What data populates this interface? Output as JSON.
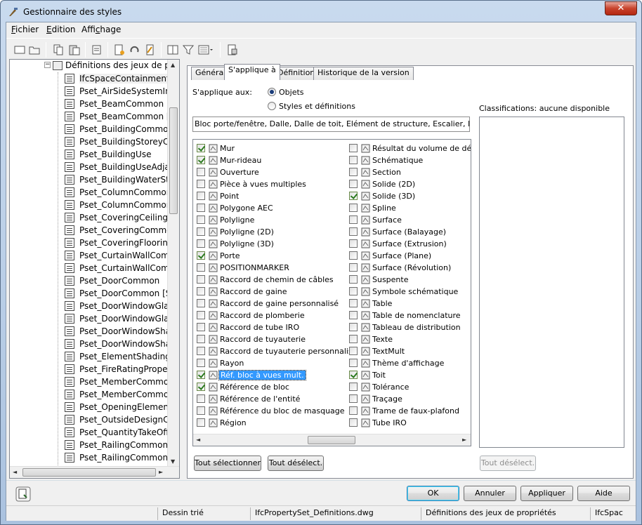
{
  "window": {
    "title": "Gestionnaire des styles",
    "close_symbol": "✕"
  },
  "menu": [
    {
      "label": "Fichier",
      "accel": "F",
      "rest": "ichier"
    },
    {
      "label": "Edition",
      "accel": "E",
      "rest": "dition"
    },
    {
      "label": "Affichage",
      "pre": "Affi",
      "accel": "c",
      "rest": "hage"
    }
  ],
  "toolbar": {
    "icons": [
      "new-drawing-icon",
      "open-drawing-icon",
      "copy-icon",
      "paste-icon",
      "purge-icon",
      "new-style-icon",
      "edit-style-icon",
      "set-from-icon",
      "toggle-view-icon",
      "filter-icon",
      "view-mode-icon",
      "synchronize-icon"
    ]
  },
  "tree": {
    "root_label": "Définitions des jeux de pro",
    "items": [
      "IfcSpaceContainment",
      "Pset_AirSideSystemInfo",
      "Pset_BeamCommon",
      "Pset_BeamCommon [S",
      "Pset_BuildingCommon",
      "Pset_BuildingStoreyCo",
      "Pset_BuildingUse",
      "Pset_BuildingUseAdjac",
      "Pset_BuildingWaterSto",
      "Pset_ColumnCommon",
      "Pset_ColumnCommon",
      "Pset_CoveringCeiling",
      "Pset_CoveringCommo",
      "Pset_CoveringFlooring",
      "Pset_CurtainWallComr",
      "Pset_CurtainWallComr",
      "Pset_DoorCommon",
      "Pset_DoorCommon [St",
      "Pset_DoorWindowGlaz",
      "Pset_DoorWindowGlaz",
      "Pset_DoorWindowShac",
      "Pset_DoorWindowShac",
      "Pset_ElementShading",
      "Pset_FireRatingPropert",
      "Pset_MemberCommon",
      "Pset_MemberCommor",
      "Pset_OpeningElementC",
      "Pset_OutsideDesignCri",
      "Pset_QuantityTakeOff",
      "Pset_RailingCommon",
      "Pset_RailingCommon |"
    ]
  },
  "tabs": [
    "Général",
    "S'applique à",
    "Définition",
    "Historique de la version"
  ],
  "applies": {
    "label": "S'applique aux:",
    "radio_objects": "Objets",
    "radio_styles": "Styles et définitions",
    "summary": "Bloc porte/fenêtre, Dalle, Dalle de toit, Elément de structure, Escalier, Fenêtre..."
  },
  "objects_left": [
    {
      "label": "Mur",
      "checked": true,
      "icon": "wall-icon"
    },
    {
      "label": "Mur-rideau",
      "checked": true,
      "icon": "curtain-wall-icon"
    },
    {
      "label": "Ouverture",
      "checked": false,
      "icon": "opening-icon"
    },
    {
      "label": "Pièce à vues multiples",
      "checked": false,
      "icon": "multi-view-part-icon"
    },
    {
      "label": "Point",
      "checked": false,
      "icon": "point-icon"
    },
    {
      "label": "Polygone AEC",
      "checked": false,
      "icon": "aec-polygon-icon"
    },
    {
      "label": "Polyligne",
      "checked": false,
      "icon": "polyline-icon"
    },
    {
      "label": "Polyligne (2D)",
      "checked": false,
      "icon": "polyline-2d-icon"
    },
    {
      "label": "Polyligne (3D)",
      "checked": false,
      "icon": "polyline-3d-icon"
    },
    {
      "label": "Porte",
      "checked": true,
      "icon": "door-icon"
    },
    {
      "label": "POSITIONMARKER",
      "checked": false,
      "icon": "position-marker-icon"
    },
    {
      "label": "Raccord de chemin de câbles",
      "checked": false,
      "icon": "cable-tray-fitting-icon"
    },
    {
      "label": "Raccord de gaine",
      "checked": false,
      "icon": "duct-fitting-icon"
    },
    {
      "label": "Raccord de gaine personnalisé",
      "checked": false,
      "icon": "custom-duct-fitting-icon"
    },
    {
      "label": "Raccord de plomberie",
      "checked": false,
      "icon": "plumbing-fitting-icon"
    },
    {
      "label": "Raccord de tube IRO",
      "checked": false,
      "icon": "conduit-fitting-icon"
    },
    {
      "label": "Raccord de tuyauterie",
      "checked": false,
      "icon": "pipe-fitting-icon"
    },
    {
      "label": "Raccord de tuyauterie personnalisé",
      "checked": false,
      "icon": "custom-pipe-fitting-icon"
    },
    {
      "label": "Rayon",
      "checked": false,
      "icon": "ray-icon"
    },
    {
      "label": "Réf. bloc à vues mult.",
      "checked": true,
      "icon": "multi-view-block-ref-icon",
      "selected": true
    },
    {
      "label": "Référence de bloc",
      "checked": true,
      "icon": "block-reference-icon"
    },
    {
      "label": "Référence de l'entité",
      "checked": false,
      "icon": "entity-reference-icon"
    },
    {
      "label": "Référence du bloc de masquage",
      "checked": false,
      "icon": "mask-block-reference-icon"
    },
    {
      "label": "Région",
      "checked": false,
      "icon": "region-icon"
    }
  ],
  "objects_right": [
    {
      "label": "Résultat du volume de délimit",
      "checked": false,
      "icon": "bounding-volume-icon"
    },
    {
      "label": "Schématique",
      "checked": false,
      "icon": "schematic-icon"
    },
    {
      "label": "Section",
      "checked": false,
      "icon": "section-icon"
    },
    {
      "label": "Solide (2D)",
      "checked": false,
      "icon": "solid-2d-icon"
    },
    {
      "label": "Solide (3D)",
      "checked": true,
      "icon": "solid-3d-icon"
    },
    {
      "label": "Spline",
      "checked": false,
      "icon": "spline-icon"
    },
    {
      "label": "Surface",
      "checked": false,
      "icon": "surface-icon"
    },
    {
      "label": "Surface (Balayage)",
      "checked": false,
      "icon": "surface-sweep-icon"
    },
    {
      "label": "Surface (Extrusion)",
      "checked": false,
      "icon": "surface-extrusion-icon"
    },
    {
      "label": "Surface (Plane)",
      "checked": false,
      "icon": "surface-plane-icon"
    },
    {
      "label": "Surface (Révolution)",
      "checked": false,
      "icon": "surface-revolution-icon"
    },
    {
      "label": "Suspente",
      "checked": false,
      "icon": "hanger-icon"
    },
    {
      "label": "Symbole schématique",
      "checked": false,
      "icon": "schematic-symbol-icon"
    },
    {
      "label": "Table",
      "checked": false,
      "icon": "table-icon"
    },
    {
      "label": "Table de nomenclature",
      "checked": false,
      "icon": "schedule-table-icon"
    },
    {
      "label": "Tableau de distribution",
      "checked": false,
      "icon": "panelboard-icon"
    },
    {
      "label": "Texte",
      "checked": false,
      "icon": "text-icon"
    },
    {
      "label": "TextMult",
      "checked": false,
      "icon": "mtext-icon"
    },
    {
      "label": "Thème d'affichage",
      "checked": false,
      "icon": "display-theme-icon"
    },
    {
      "label": "Toit",
      "checked": true,
      "icon": "roof-icon"
    },
    {
      "label": "Tolérance",
      "checked": false,
      "icon": "tolerance-icon"
    },
    {
      "label": "Traçage",
      "checked": false,
      "icon": "trace-icon"
    },
    {
      "label": "Trame de faux-plafond",
      "checked": false,
      "icon": "ceiling-grid-icon"
    },
    {
      "label": "Tube IRO",
      "checked": false,
      "icon": "conduit-icon"
    }
  ],
  "buttons": {
    "select_all": "Tout sélectionner",
    "deselect_all": "Tout désélect.",
    "class_deselect": "Tout désélect.",
    "ok": "OK",
    "cancel": "Annuler",
    "apply": "Appliquer",
    "help": "Aide"
  },
  "classifications": {
    "label": "Classifications: aucune disponible"
  },
  "status": {
    "sort": "Dessin trié",
    "drawing": "IfcPropertySet_Definitions.dwg",
    "category": "Définitions des jeux de propriétés",
    "item": "IfcSpac"
  },
  "colors": {
    "selection": "#3399ff",
    "check": "#2b7a1f",
    "title_bg": "#c9daee"
  }
}
